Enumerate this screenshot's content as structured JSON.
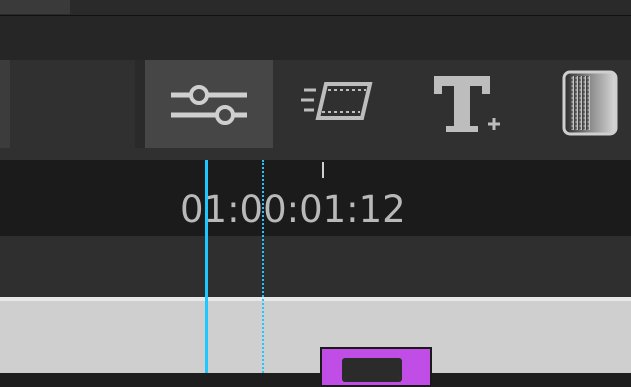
{
  "timeline": {
    "timecode": "01:00:01:12"
  },
  "toolbar": {
    "buttons": [
      {
        "icon": "sliders-icon",
        "active": true
      },
      {
        "icon": "transition-icon",
        "active": false
      },
      {
        "icon": "text-title-icon",
        "active": false
      },
      {
        "icon": "generator-icon",
        "active": false
      }
    ]
  },
  "colors": {
    "playhead": "#1ec8ff",
    "clip": "#c04ee6",
    "icon": "#cfcfcf"
  }
}
